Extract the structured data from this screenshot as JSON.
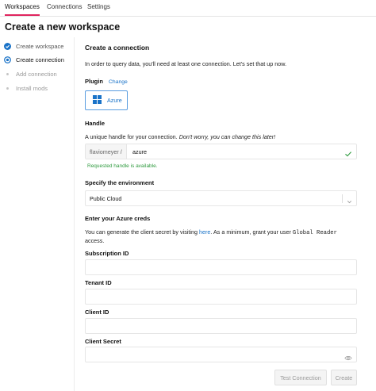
{
  "nav": {
    "tabs": [
      {
        "label": "Workspaces"
      },
      {
        "label": "Connections"
      },
      {
        "label": "Settings"
      }
    ]
  },
  "page": {
    "title": "Create a new workspace"
  },
  "steps": [
    {
      "label": "Create workspace",
      "state": "done"
    },
    {
      "label": "Create connection",
      "state": "current"
    },
    {
      "label": "Add connection",
      "state": "pending"
    },
    {
      "label": "Install mods",
      "state": "pending"
    }
  ],
  "connection": {
    "title": "Create a connection",
    "intro": "In order to query data, you'll need at least one connection. Let's set that up now.",
    "plugin": {
      "label": "Plugin",
      "change_link": "Change",
      "name": "Azure"
    },
    "handle": {
      "label": "Handle",
      "help_text": "A unique handle for your connection.",
      "help_italic": "Don't worry, you can change this later!",
      "prefix": "flaviomeyer /",
      "value": "azure",
      "status": "Requested handle is available."
    },
    "environment": {
      "label": "Specify the environment",
      "selected": "Public Cloud"
    },
    "creds": {
      "heading": "Enter your Azure creds",
      "help_pre": "You can generate the client secret by visiting",
      "help_link": "here",
      "help_mid": ". As a minimum, grant your user",
      "help_code": "Global Reader",
      "help_end": "access."
    },
    "fields": [
      {
        "label": "Subscription ID",
        "value": ""
      },
      {
        "label": "Tenant ID",
        "value": ""
      },
      {
        "label": "Client ID",
        "value": ""
      },
      {
        "label": "Client Secret",
        "value": ""
      }
    ]
  },
  "actions": {
    "test_label": "Test Connection",
    "create_label": "Create"
  },
  "colors": {
    "accent": "#e0245e",
    "primary": "#1a73c8",
    "success": "#2e9a3e"
  },
  "icons": {
    "plugin": "azure-logo-icon",
    "handle_ok": "check-icon",
    "select": "chevron-down-icon",
    "secret": "eye-icon",
    "step_done": "check-circle-icon",
    "step_current": "radio-current-icon",
    "step_pending": "dot-icon"
  }
}
